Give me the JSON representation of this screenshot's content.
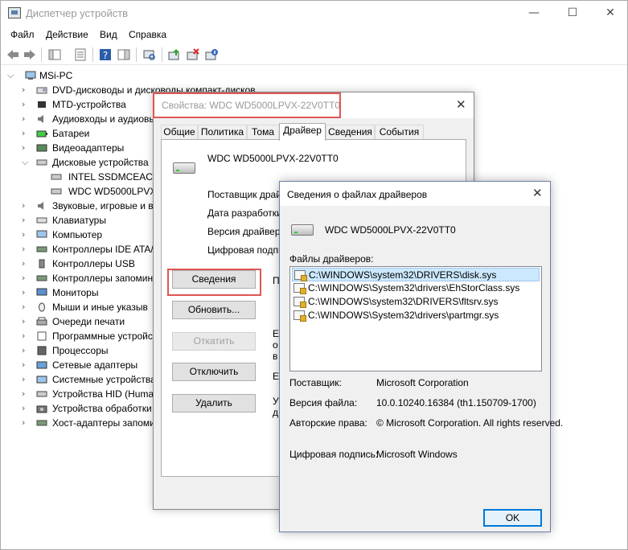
{
  "main": {
    "title": "Диспетчер устройств",
    "controls": {
      "minimize": "—",
      "maximize": "☐",
      "close": "✕"
    },
    "menu": [
      "Файл",
      "Действие",
      "Вид",
      "Справка"
    ],
    "tree": {
      "root": "MSi-PC",
      "items": [
        "DVD-дисководы и дисководы компакт-дисков",
        "MTD-устройства",
        "Аудиовходы и аудиовыходы",
        "Батареи",
        "Видеоадаптеры",
        "Дисковые устройства",
        "INTEL SSDMCEAC12",
        "WDC WD5000LPVX-2",
        "Звуковые, игровые и в",
        "Клавиатуры",
        "Компьютер",
        "Контроллеры IDE ATA/",
        "Контроллеры USB",
        "Контроллеры запомин",
        "Мониторы",
        "Мыши и иные указыв",
        "Очереди печати",
        "Программные устройс",
        "Процессоры",
        "Сетевые адаптеры",
        "Системные устройства",
        "Устройства HID (Huma",
        "Устройства обработки",
        "Хост-адаптеры запоми"
      ]
    }
  },
  "props": {
    "title": "Свойства: WDC WD5000LPVX-22V0TT0",
    "close": "✕",
    "tabs": [
      "Общие",
      "Политика",
      "Тома",
      "Драйвер",
      "Сведения",
      "События"
    ],
    "device_name": "WDC WD5000LPVX-22V0TT0",
    "labels": [
      "Поставщик драйвера:",
      "Дата разработки:",
      "Версия драйвера:",
      "Цифровая подпись:"
    ],
    "buttons": [
      "Сведения",
      "Обновить...",
      "Откатить",
      "Отключить",
      "Удалить"
    ],
    "side_texts": [
      "П",
      "Е",
      "о",
      "в",
      "Е",
      "У",
      "д"
    ]
  },
  "drv": {
    "title": "Сведения о файлах драйверов",
    "close": "✕",
    "device_name": "WDC WD5000LPVX-22V0TT0",
    "files_label": "Файлы драйверов:",
    "files": [
      "C:\\WINDOWS\\system32\\DRIVERS\\disk.sys",
      "C:\\WINDOWS\\System32\\drivers\\EhStorClass.sys",
      "C:\\WINDOWS\\system32\\DRIVERS\\fltsrv.sys",
      "C:\\WINDOWS\\System32\\drivers\\partmgr.sys"
    ],
    "provider_label": "Поставщик:",
    "provider": "Microsoft Corporation",
    "version_label": "Версия файла:",
    "version": "10.0.10240.16384 (th1.150709-1700)",
    "copyright_label": "Авторские права:",
    "copyright": "© Microsoft Corporation. All rights reserved.",
    "signature_label": "Цифровая подпись:",
    "signature": "Microsoft Windows",
    "ok": "OK"
  }
}
